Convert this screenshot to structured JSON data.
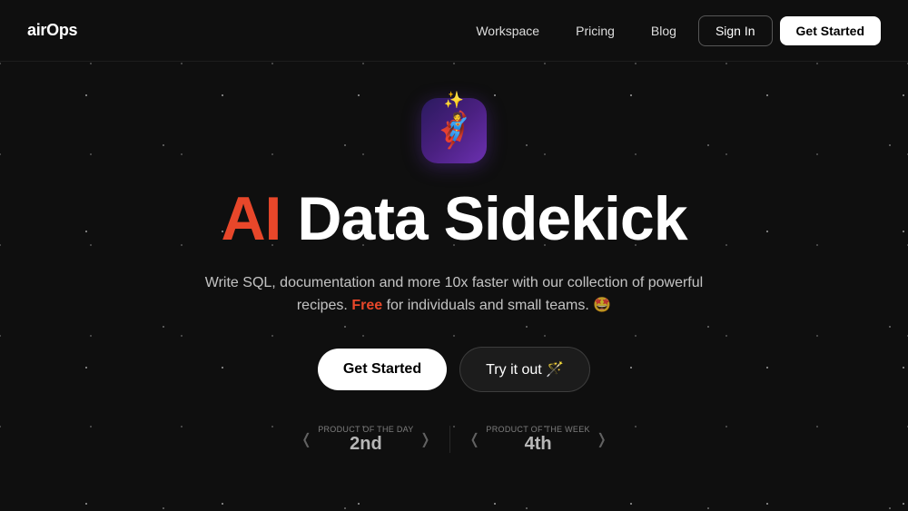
{
  "logo": {
    "text": "airOps",
    "air": "air",
    "ops": "Ops"
  },
  "nav": {
    "links": [
      {
        "label": "Workspace",
        "id": "workspace"
      },
      {
        "label": "Pricing",
        "id": "pricing"
      },
      {
        "label": "Blog",
        "id": "blog"
      }
    ],
    "signin_label": "Sign In",
    "getstarted_label": "Get Started"
  },
  "hero": {
    "icon_emoji": "🦸",
    "title_ai": "AI",
    "title_rest": " Data Sidekick",
    "subtitle_before_free": "Write SQL, documentation and more 10x faster with our collection of powerful recipes.",
    "subtitle_free": "Free",
    "subtitle_after_free": " for individuals and small teams. 🤩",
    "btn_getstarted": "Get Started",
    "btn_tryitout": "Try it out 🪄"
  },
  "badges": [
    {
      "label": "Product of the day",
      "number": "2nd"
    },
    {
      "label": "Product of the week",
      "number": "4th"
    }
  ]
}
